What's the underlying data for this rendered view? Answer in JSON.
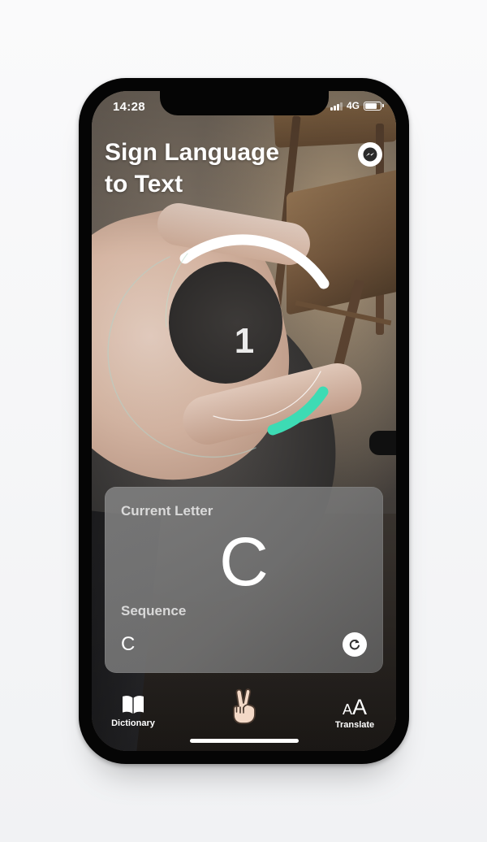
{
  "status_bar": {
    "time": "14:28",
    "network": "4G"
  },
  "header": {
    "title_line1": "Sign Language",
    "title_line2": "to Text",
    "messenger_icon": "messenger-icon"
  },
  "detector": {
    "countdown": "1",
    "accent_color": "#3ddbb4"
  },
  "card": {
    "current_letter_label": "Current Letter",
    "current_letter": "C",
    "sequence_label": "Sequence",
    "sequence": "C",
    "reset_icon": "refresh-icon"
  },
  "tab_bar": {
    "dictionary_label": "Dictionary",
    "dictionary_icon": "book-icon",
    "gesture_icon": "victory-hand-icon",
    "translate_label": "Translate",
    "translate_icon": "text-size-icon",
    "translate_glyph_small": "A",
    "translate_glyph_large": "A"
  }
}
